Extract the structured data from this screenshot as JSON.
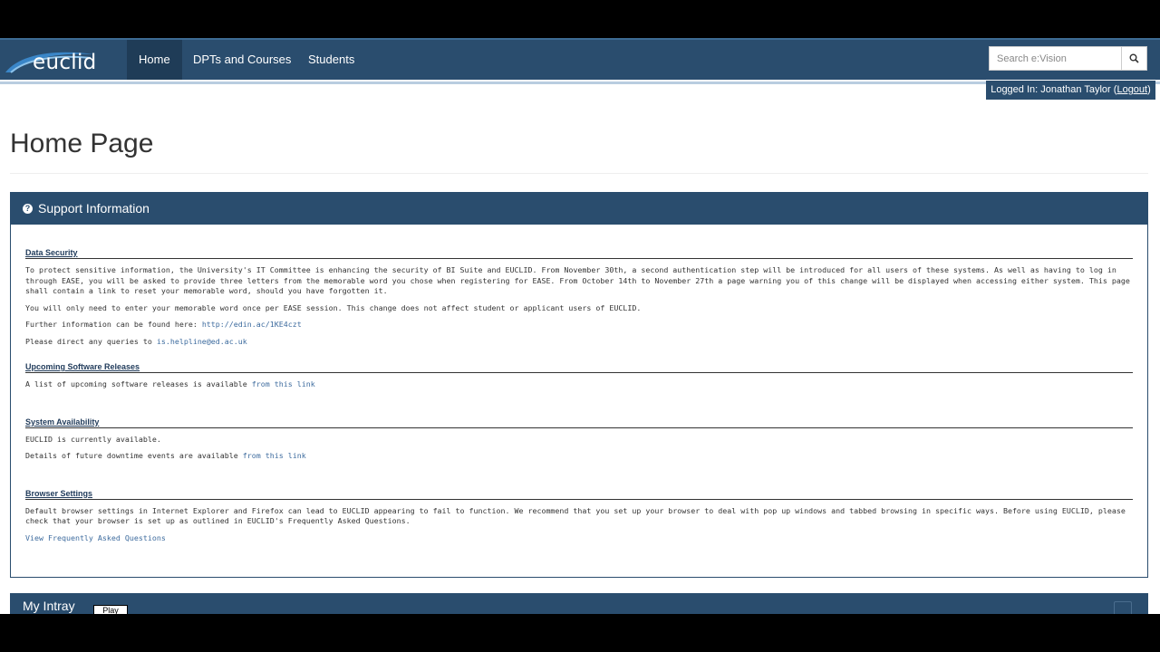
{
  "app": {
    "logo_text": "euclid"
  },
  "nav": {
    "items": [
      {
        "label": "Home",
        "active": true
      },
      {
        "label": "DPTs and Courses",
        "active": false
      },
      {
        "label": "Students",
        "active": false
      }
    ],
    "search_placeholder": "Search e:Vision"
  },
  "user": {
    "logged_in_label": "Logged In: Jonathan Taylor",
    "open_paren": " (",
    "logout_label": "Logout",
    "close_paren": ")"
  },
  "page": {
    "title": "Home Page"
  },
  "support_panel": {
    "title": "Support Information",
    "sections": {
      "data_security": {
        "title": "Data Security",
        "p1": "To protect sensitive information, the University's IT Committee is enhancing the security of BI Suite and EUCLID. From November 30th, a second authentication step will be introduced for all users of these systems. As well as having to log in through EASE, you will be asked to provide three letters from the memorable word you chose when registering for EASE. From October 14th to November 27th a page warning you of this change will be displayed when accessing either system. This page shall contain a link to reset your memorable word, should you have forgotten it.",
        "p2": "You will only need to enter your memorable word once per EASE session. This change does not affect student or applicant users of EUCLID.",
        "p3_text": "Further information can be found here: ",
        "p3_link": "http://edin.ac/1KE4czt",
        "p4_text": "Please direct any queries to ",
        "p4_link": "is.helpline@ed.ac.uk"
      },
      "software_releases": {
        "title": "Upcoming Software Releases",
        "p1_text": "A list of upcoming software releases is available ",
        "p1_link": "from this link"
      },
      "system_availability": {
        "title": "System Availability",
        "p1": "EUCLID is currently available.",
        "p2_text": "Details of future downtime events are available ",
        "p2_link": "from this link"
      },
      "browser_settings": {
        "title": "Browser Settings",
        "p1": "Default browser settings in Internet Explorer and Firefox can lead to EUCLID appearing to fail to function. We recommend that you set up your browser to deal with pop up windows and tabbed browsing in specific ways. Before using EUCLID, please check that your browser is set up as outlined in EUCLID's Frequently Asked Questions.",
        "faq_link": "View Frequently Asked Questions"
      }
    }
  },
  "intray_panel": {
    "title": "My Intray",
    "play_label": "Play"
  },
  "colors": {
    "navbar": "#2a4d6e",
    "navbar_active": "#1f3c57",
    "link": "#3d6b9e"
  }
}
